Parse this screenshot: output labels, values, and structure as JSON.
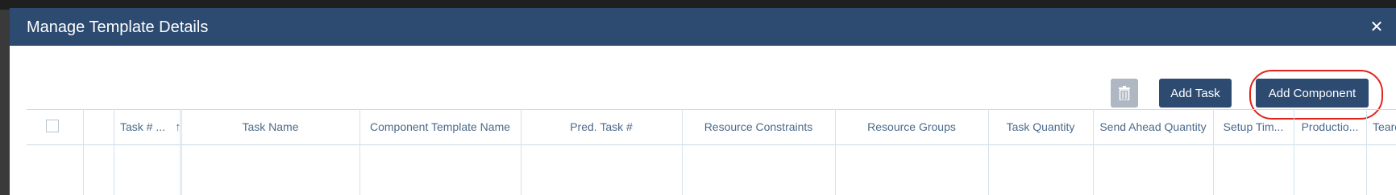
{
  "dialog": {
    "title": "Manage Template Details",
    "close_glyph": "✕"
  },
  "toolbar": {
    "delete_icon": "trash-icon",
    "add_task_label": "Add Task",
    "add_component_label": "Add Component"
  },
  "table": {
    "sort_icon": "↑",
    "columns": [
      "Task # ...",
      "Task Name",
      "Component Template Name",
      "Pred. Task #",
      "Resource Constraints",
      "Resource Groups",
      "Task Quantity",
      "Send Ahead Quantity",
      "Setup Tim...",
      "Productio...",
      "Teardo"
    ]
  },
  "colors": {
    "header": "#2d4a70",
    "primary_button": "#2d4a70",
    "disabled_button": "#aeb7c2",
    "annotation": "#e0241c",
    "column_text": "#4a6a8a"
  }
}
